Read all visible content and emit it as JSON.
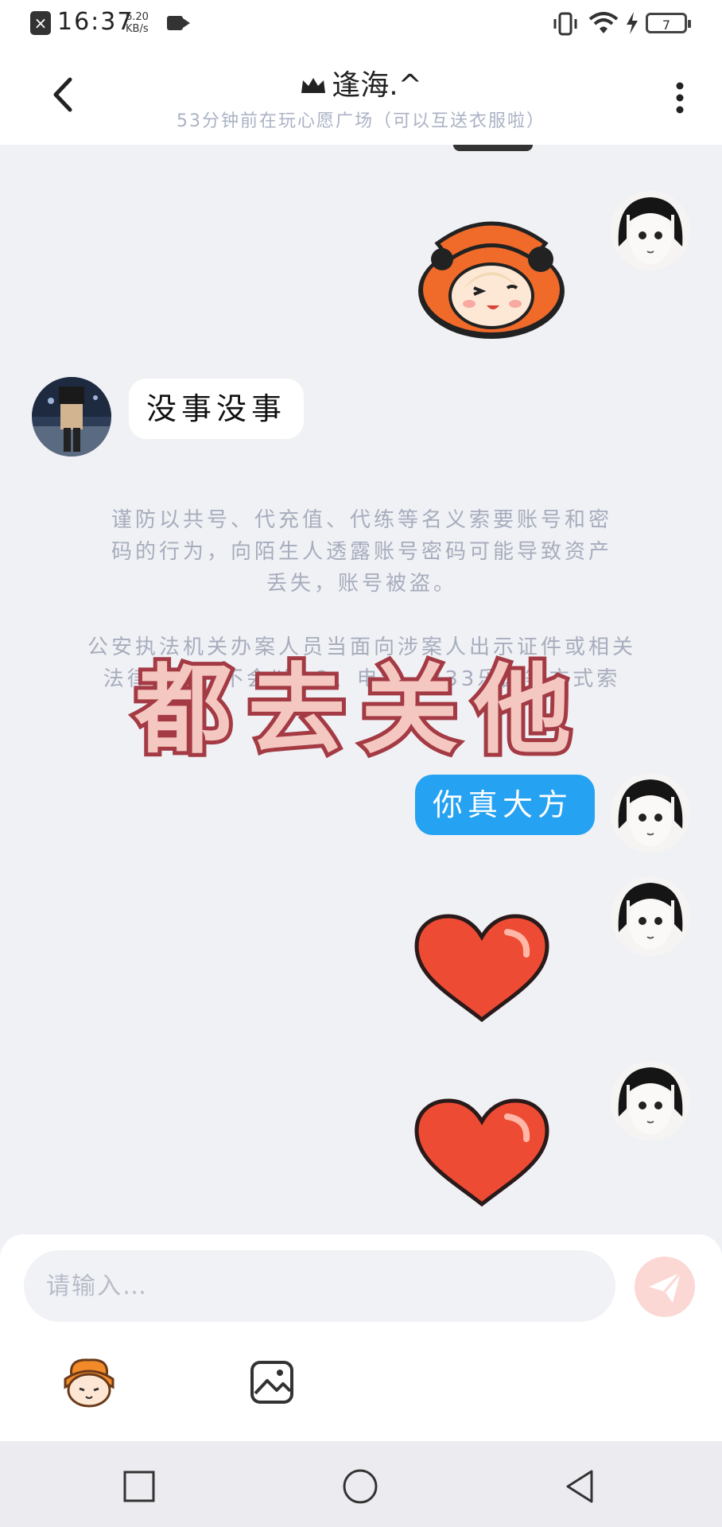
{
  "status_bar": {
    "time": "16:37",
    "speed_value": "6.20",
    "speed_unit": "KB/s",
    "battery": "7"
  },
  "header": {
    "title": "逢海.^",
    "subtitle": "53分钟前在玩心愿广场（可以互送衣服啦）",
    "back_icon": "chevron-left-icon",
    "menu_icon": "more-vertical-icon",
    "crown_icon": "crown-icon"
  },
  "chat": {
    "left_message": "没事没事",
    "notice_lines": [
      "谨防以共号、代充值、代练等名义索要账号和密",
      "码的行为，向陌生人透露账号密码可能导致资产",
      "丢失，账号被盗。",
      "",
      "公安执法机关办案人员当面向涉案人出示证件或相关",
      "法律文书，不会以QQ、电话、233乐园等方式索"
    ],
    "right_message": "你真大方",
    "overlay_caption": "都去关他"
  },
  "input": {
    "placeholder": "请输入…"
  },
  "colors": {
    "bubble_blue": "#26a2f2",
    "heart_red": "#ee4b34",
    "overlay_stroke": "#a43a44",
    "overlay_fill": "#f4c8c0"
  }
}
